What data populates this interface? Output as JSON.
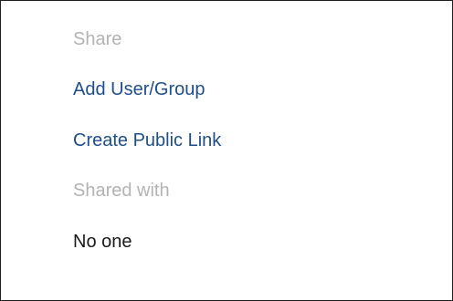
{
  "share_section": {
    "header": "Share",
    "actions": [
      {
        "label": "Add User/Group"
      },
      {
        "label": "Create Public Link"
      }
    ]
  },
  "shared_with_section": {
    "header": "Shared with",
    "value": "No one"
  },
  "colors": {
    "header_text": "#b3b3b3",
    "link_text": "#1f4e8c",
    "body_text": "#1a1a1a",
    "border": "#1f1f1f",
    "background": "#ffffff"
  }
}
